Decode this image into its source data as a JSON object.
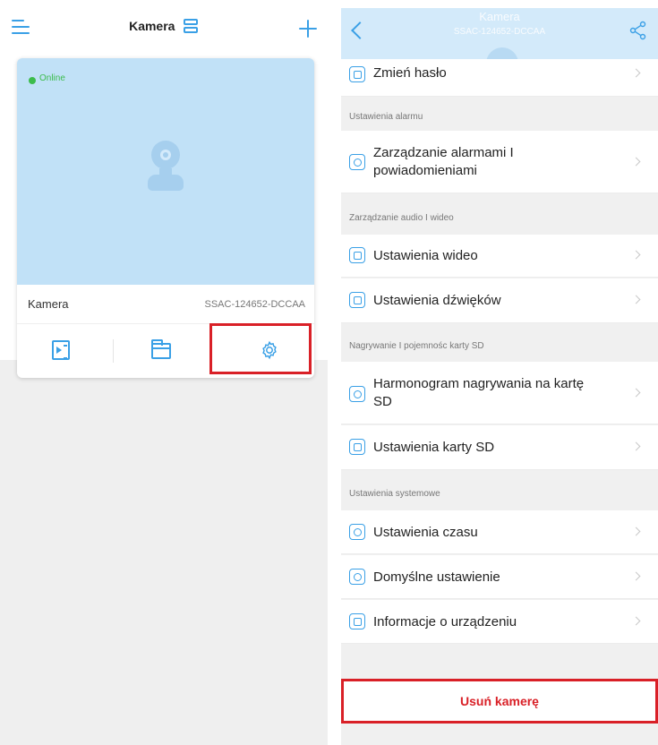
{
  "left_screen": {
    "header": {
      "title": "Kamera",
      "menu_icon": "menu-icon",
      "layout_icon": "layout-toggle-icon",
      "add_icon": "plus-icon"
    },
    "camera_card": {
      "status": "Online",
      "name": "Kamera",
      "device_id": "SSAC-124652-DCCAA",
      "actions": [
        "playback-icon",
        "folder-icon",
        "gear-icon"
      ],
      "highlighted_action": "settings"
    }
  },
  "right_screen": {
    "header": {
      "title": "Kamera",
      "subtitle": "SSAC-124652-DCCAA",
      "back_icon": "chevron-left-icon",
      "share_icon": "share-icon"
    },
    "items": {
      "change_password": "Zmień hasło",
      "alarm_management_line1": "Zarządzanie alarmami I",
      "alarm_management_line2": "powiadomieniami",
      "video_settings": "Ustawienia wideo",
      "sound_settings": "Ustawienia dźwięków",
      "recording_schedule_line1": "Harmonogram nagrywania na kartę",
      "recording_schedule_line2": "SD",
      "sd_card_settings": "Ustawienia karty SD",
      "time_settings": "Ustawienia czasu",
      "default_settings": "Domyślne ustawienie",
      "device_info": "Informacje o urządzeniu"
    },
    "sections": {
      "alarm": "Ustawienia alarmu",
      "audio_video": "Zarządzanie audio I wideo",
      "recording": "Nagrywanie I pojemnośc karty SD",
      "system": "Ustawienia systemowe"
    },
    "delete_button": "Usuń kamerę"
  },
  "colors": {
    "accent": "#3aa0e6",
    "highlight": "#d92027",
    "online": "#3cbc4c",
    "preview_bg": "#c1e1f7"
  }
}
